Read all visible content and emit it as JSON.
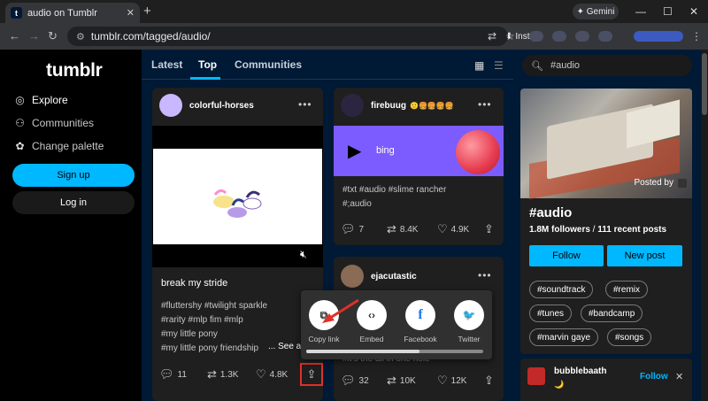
{
  "browser": {
    "tab_title": "audio on Tumblr",
    "tab_favicon": "t",
    "close_tab": "✕",
    "new_tab": "+",
    "gemini_label": "✦ Gemini",
    "url": "tumblr.com/tagged/audio/",
    "install_label": "Install",
    "minimize": "—",
    "maximize": "☐",
    "close": "✕"
  },
  "sidebar": {
    "logo": "tumblr",
    "items": [
      {
        "label": "Explore",
        "icon": "compass-icon"
      },
      {
        "label": "Communities",
        "icon": "people-icon"
      },
      {
        "label": "Change palette",
        "icon": "palette-icon"
      }
    ],
    "signup": "Sign up",
    "login": "Log in"
  },
  "feed": {
    "tabs": [
      "Latest",
      "Top",
      "Communities"
    ],
    "active_tab": "Top",
    "posts": [
      {
        "author": "colorful-horses",
        "title": "break my stride",
        "tags": [
          "#fluttershy  #twilight sparkle",
          "#rarity  #mlp fim  #mlp",
          "#my little pony",
          "#my little pony friendship"
        ],
        "see_more": "... See a",
        "replies": "11",
        "reblogs": "1.3K",
        "likes": "4.8K"
      },
      {
        "author": "firebuug",
        "badges": "🙂🍔🍔🍔🍔",
        "audio_title": "bing",
        "tags": [
          "#txt  #audio  #slime rancher",
          "#;audio"
        ],
        "replies": "7",
        "reblogs": "8.4K",
        "likes": "4.9K"
      },
      {
        "author": "ejacutastic",
        "tags_partial": "#it's the all in one hole",
        "replies": "32",
        "reblogs": "10K",
        "likes": "12K"
      }
    ]
  },
  "share_menu": {
    "options": [
      {
        "label": "Copy link",
        "icon": "copy-link-icon",
        "glyph": "⧉"
      },
      {
        "label": "Embed",
        "icon": "embed-icon",
        "glyph": "‹›"
      },
      {
        "label": "Facebook",
        "icon": "facebook-icon",
        "glyph": "f"
      },
      {
        "label": "Twitter",
        "icon": "twitter-icon",
        "glyph": "🐦"
      }
    ]
  },
  "right": {
    "search_value": "#audio",
    "posted_by": "Posted by",
    "tag_title": "#audio",
    "followers": "1.8M followers",
    "sep": " / ",
    "recent": "111 recent posts",
    "follow": "Follow",
    "new_post": "New post",
    "chips": [
      "#soundtrack",
      "#remix",
      "#tunes",
      "#bandcamp",
      "#marvin gaye",
      "#songs"
    ],
    "suggestion": {
      "name": "bubblebaath",
      "sub": "🌙",
      "follow": "Follow",
      "dismiss": "✕"
    }
  },
  "colors": {
    "accent": "#00b8ff",
    "feed_bg": "#001935",
    "card_bg": "#1f1f1f",
    "audio_purple": "#7c5cff",
    "highlight_red": "#e0302a"
  }
}
